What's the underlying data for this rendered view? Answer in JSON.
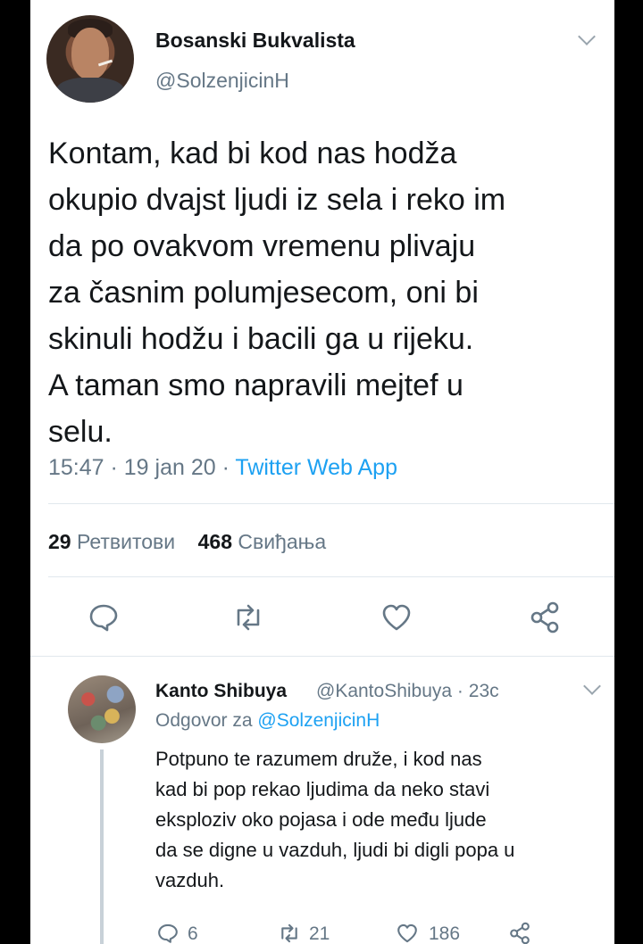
{
  "tweet": {
    "author_name": "Bosanski Bukvalista",
    "author_handle": "@SolzenjicinH",
    "text": "Kontam, kad bi kod nas hodža\nokupio dvajst ljudi iz sela i reko im\nda po ovakvom vremenu plivaju\nza časnim polumjesecom, oni bi\nskinuli hodžu i bacili ga u rijeku.\nA taman smo napravili mejtef u\nselu.",
    "time": "15:47",
    "date": "19 jan 20",
    "source": "Twitter Web App",
    "retweets_count": "29",
    "retweets_label": "Ретвитови",
    "likes_count": "468",
    "likes_label": "Свиђања"
  },
  "reply": {
    "author_name": "Kanto Shibuya",
    "author_handle": "@KantoShibuya",
    "age": "23c",
    "replying_to_label": "Odgovor za",
    "replying_to_handle": "@SolzenjicinH",
    "text": "Potpuno te razumem druže, i kod nas\nkad bi pop rekao ljudima da neko stavi\neksploziv oko pojasa i ode među ljude\nda se digne u vazduh, ljudi bi digli popa u\nvazduh.",
    "reply_count": "6",
    "retweet_count": "21",
    "like_count": "186"
  },
  "icons": {
    "reply": "reply-icon",
    "retweet": "retweet-icon",
    "like": "heart-icon",
    "share": "share-icon",
    "more": "chevron-down-icon"
  },
  "colors": {
    "accent": "#1da1f2",
    "muted": "#657786",
    "text": "#14171a"
  }
}
